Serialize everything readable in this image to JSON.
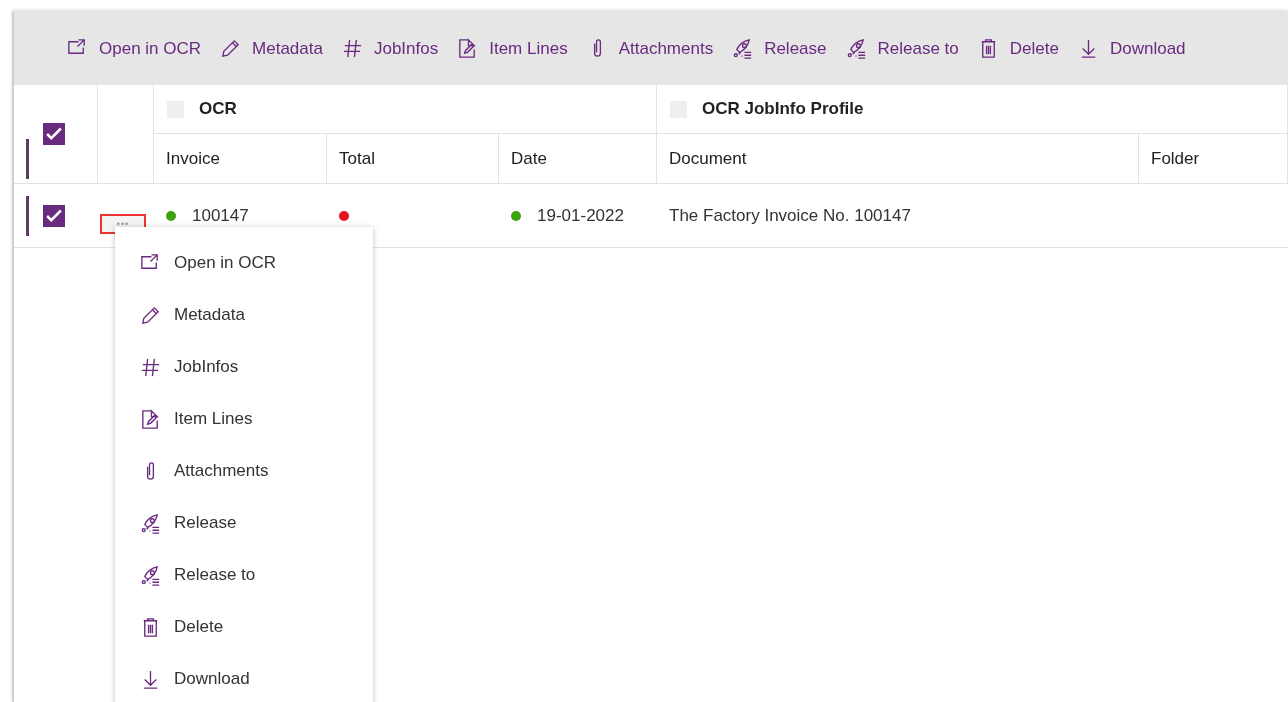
{
  "toolbar": [
    {
      "kind": "open",
      "label": "Open in OCR"
    },
    {
      "kind": "edit",
      "label": "Metadata"
    },
    {
      "kind": "hash",
      "label": "JobInfos"
    },
    {
      "kind": "lines",
      "label": "Item Lines"
    },
    {
      "kind": "clip",
      "label": "Attachments"
    },
    {
      "kind": "rocket",
      "label": "Release"
    },
    {
      "kind": "rocket",
      "label": "Release to"
    },
    {
      "kind": "trash",
      "label": "Delete"
    },
    {
      "kind": "download",
      "label": "Download"
    }
  ],
  "table": {
    "select_all": {
      "checked": true
    },
    "groups": [
      {
        "label": "OCR",
        "checked": false
      },
      {
        "label": "OCR JobInfo Profile",
        "checked": false
      }
    ],
    "columns": [
      "Invoice",
      "Total",
      "Date",
      "Document",
      "Folder"
    ],
    "rows": [
      {
        "checked": true,
        "selected": true,
        "more": "•••",
        "cells": [
          {
            "text": "100147",
            "color": "#3aa30f"
          },
          {
            "text": "",
            "color": "#e8141b"
          },
          {
            "text": "19-01-2022",
            "color": "#3aa30f"
          },
          {
            "text": "The Factory Invoice No. 100147"
          },
          {
            "text": ""
          }
        ]
      }
    ]
  },
  "context_menu": [
    {
      "kind": "open",
      "label": "Open in OCR"
    },
    {
      "kind": "edit",
      "label": "Metadata"
    },
    {
      "kind": "hash",
      "label": "JobInfos"
    },
    {
      "kind": "lines",
      "label": "Item Lines"
    },
    {
      "kind": "clip",
      "label": "Attachments"
    },
    {
      "kind": "rocket",
      "label": "Release"
    },
    {
      "kind": "rocket",
      "label": "Release to"
    },
    {
      "kind": "trash",
      "label": "Delete"
    },
    {
      "kind": "download",
      "label": "Download"
    }
  ]
}
